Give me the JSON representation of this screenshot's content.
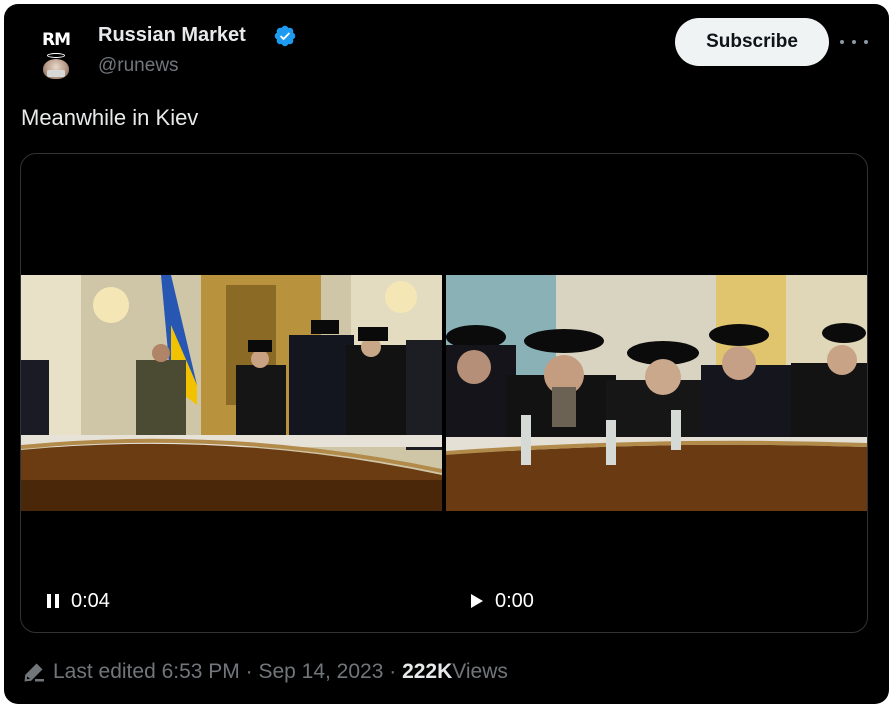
{
  "account": {
    "avatar_text": "RM",
    "name": "Russian Market",
    "handle": "@runews",
    "verified_color": "#1d9bf0"
  },
  "actions": {
    "subscribe_label": "Subscribe",
    "more_icon": "more-horizontal-icon"
  },
  "post": {
    "text": "Meanwhile in Kiev"
  },
  "media": {
    "videos": [
      {
        "state": "playing",
        "control_icon": "pause-icon",
        "time": "0:04"
      },
      {
        "state": "paused",
        "control_icon": "play-icon",
        "time": "0:00"
      }
    ]
  },
  "footer": {
    "edit_icon": "pencil-icon",
    "edited_text": "Last edited 6:53 PM · Sep 14, 2023 · ",
    "views_count": "222K",
    "views_label": " Views"
  },
  "colors": {
    "background": "#000000",
    "text_primary": "#e7e9ea",
    "text_secondary": "#71767b",
    "button_bg": "#eff3f4",
    "border": "#2f3336"
  }
}
